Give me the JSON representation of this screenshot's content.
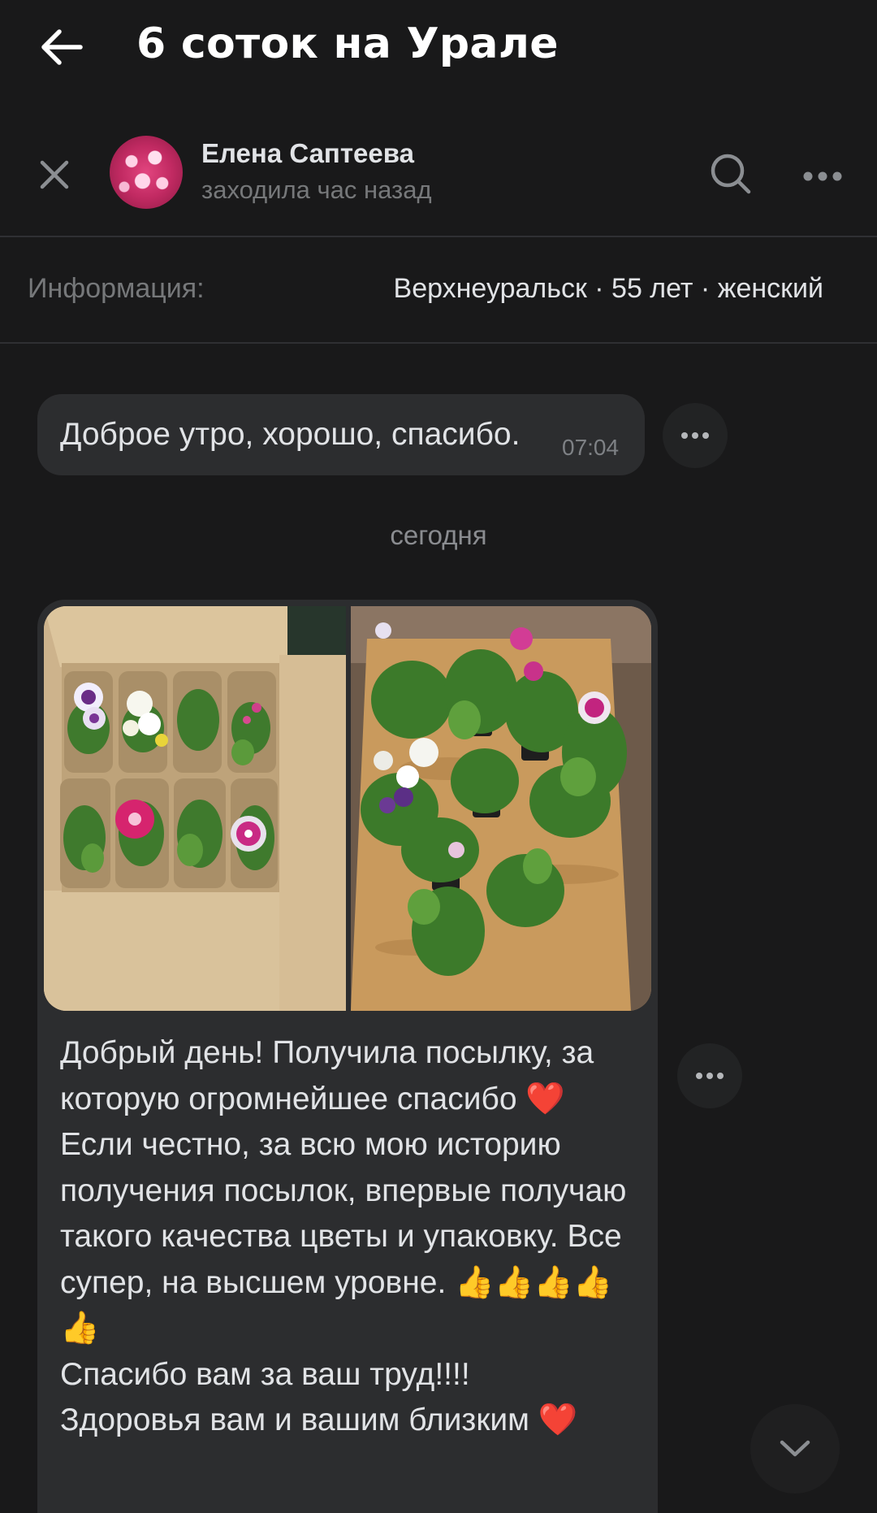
{
  "header": {
    "title": "6 соток на Урале"
  },
  "contact": {
    "name": "Елена Саптеева",
    "status": "заходила час назад"
  },
  "info": {
    "label": "Информация:",
    "value": "Верхнеуральск · 55 лет · женский"
  },
  "messages": [
    {
      "text": "Доброе утро, хорошо, спасибо.",
      "time": "07:04"
    },
    {
      "date_separator": "сегодня",
      "attachments": [
        "photo-box-with-flowers",
        "photo-flowers-on-table"
      ],
      "text": "Добрый день! Получила посылку, за которую огромнейшее спасибо ❤️\nЕсли честно, за всю мою историю получения посылок, впервые получаю такого качества цветы и упаковку. Все супер, на высшем уровне. 👍👍👍👍👍\nСпасибо вам за ваш труд!!!!\nЗдоровья вам и вашим близким ❤️"
    }
  ],
  "colors": {
    "background": "#19191a",
    "bubble": "#2c2d2f",
    "text_primary": "#e1e3e6",
    "text_secondary": "#76787a"
  }
}
